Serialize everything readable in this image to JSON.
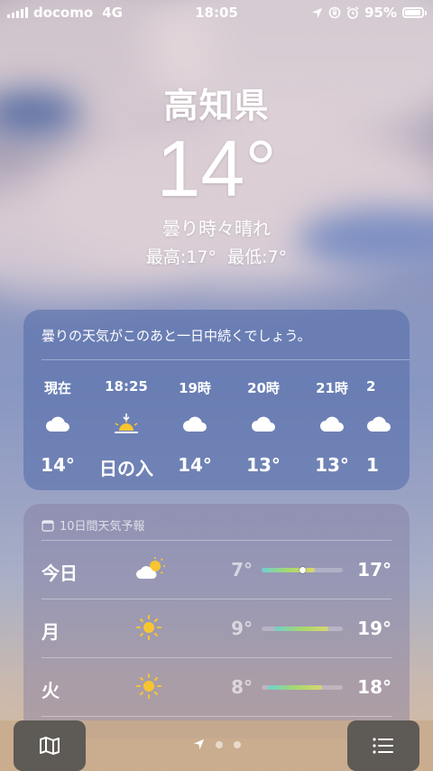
{
  "status_bar": {
    "carrier": "docomo",
    "network": "4G",
    "time": "18:05",
    "battery_percent": "95%",
    "battery_level": 0.95
  },
  "hero": {
    "location": "高知県",
    "temperature": "14°",
    "condition": "曇り時々晴れ",
    "hi_lo": "最高:17°  最低:7°"
  },
  "hourly": {
    "summary": "曇りの天気がこのあと一日中続くでしょう。",
    "items": [
      {
        "time": "現在",
        "icon": "cloud-icon",
        "temp": "14°"
      },
      {
        "time": "18:25",
        "icon": "sunset-icon",
        "temp": "日の入"
      },
      {
        "time": "19時",
        "icon": "cloud-icon",
        "temp": "14°"
      },
      {
        "time": "20時",
        "icon": "cloud-icon",
        "temp": "13°"
      },
      {
        "time": "21時",
        "icon": "cloud-icon",
        "temp": "13°"
      },
      {
        "time": "2",
        "icon": "cloud-icon",
        "temp": "1"
      }
    ]
  },
  "daily": {
    "header": "10日間天気予報",
    "days": [
      {
        "day": "今日",
        "icon": "partly-cloudy-icon",
        "low": "7°",
        "high": "17°",
        "range_start": 0.0,
        "range_end": 0.66,
        "current": 0.5
      },
      {
        "day": "月",
        "icon": "sun-icon",
        "low": "9°",
        "high": "19°",
        "range_start": 0.16,
        "range_end": 0.82
      },
      {
        "day": "火",
        "icon": "sun-icon",
        "low": "8°",
        "high": "18°",
        "range_start": 0.08,
        "range_end": 0.74
      }
    ]
  },
  "colors": {
    "range_gradient": [
      "#6ed0d0",
      "#a6d86e",
      "#d8d66e"
    ],
    "sun": "#f7c531"
  }
}
